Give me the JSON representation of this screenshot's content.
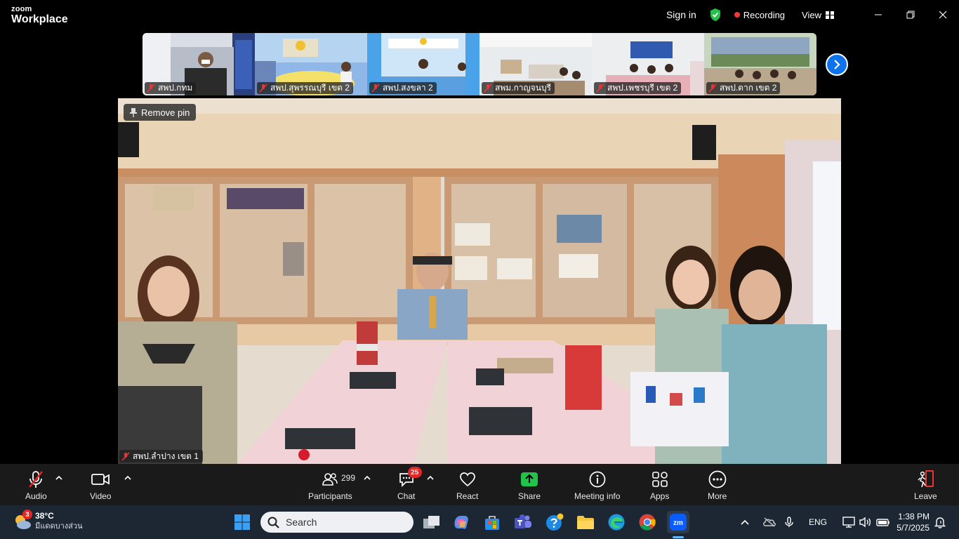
{
  "app": {
    "logo_line1": "zoom",
    "logo_line2": "Workplace"
  },
  "titlebar": {
    "signin": "Sign in",
    "recording": "Recording",
    "view": "View",
    "accent": "#0e72ed",
    "rec_color": "#f03a3a"
  },
  "thumbnails": [
    {
      "label": "สพป.กทม"
    },
    {
      "label": "สพป.สุพรรณบุรี เขต 2"
    },
    {
      "label": "สพป.สงขลา 2"
    },
    {
      "label": "สพม.กาญจนบุรี"
    },
    {
      "label": "สพป.เพชรบุรี เขต 2"
    },
    {
      "label": "สพป.ตาก เขต 2"
    }
  ],
  "main": {
    "remove_pin": "Remove pin",
    "speaker_label": "สพป.ลำปาง เขต 1"
  },
  "toolbar": {
    "audio": "Audio",
    "video": "Video",
    "participants": "Participants",
    "participants_count": "299",
    "chat": "Chat",
    "chat_badge": "25",
    "react": "React",
    "share": "Share",
    "meeting_info": "Meeting info",
    "apps": "Apps",
    "more": "More",
    "leave": "Leave"
  },
  "taskbar": {
    "weather_temp": "38°C",
    "weather_desc": "มีแดดบางส่วน",
    "weather_badge": "3",
    "search_placeholder": "Search",
    "lang": "ENG",
    "time": "1:38 PM",
    "date": "5/7/2025"
  }
}
